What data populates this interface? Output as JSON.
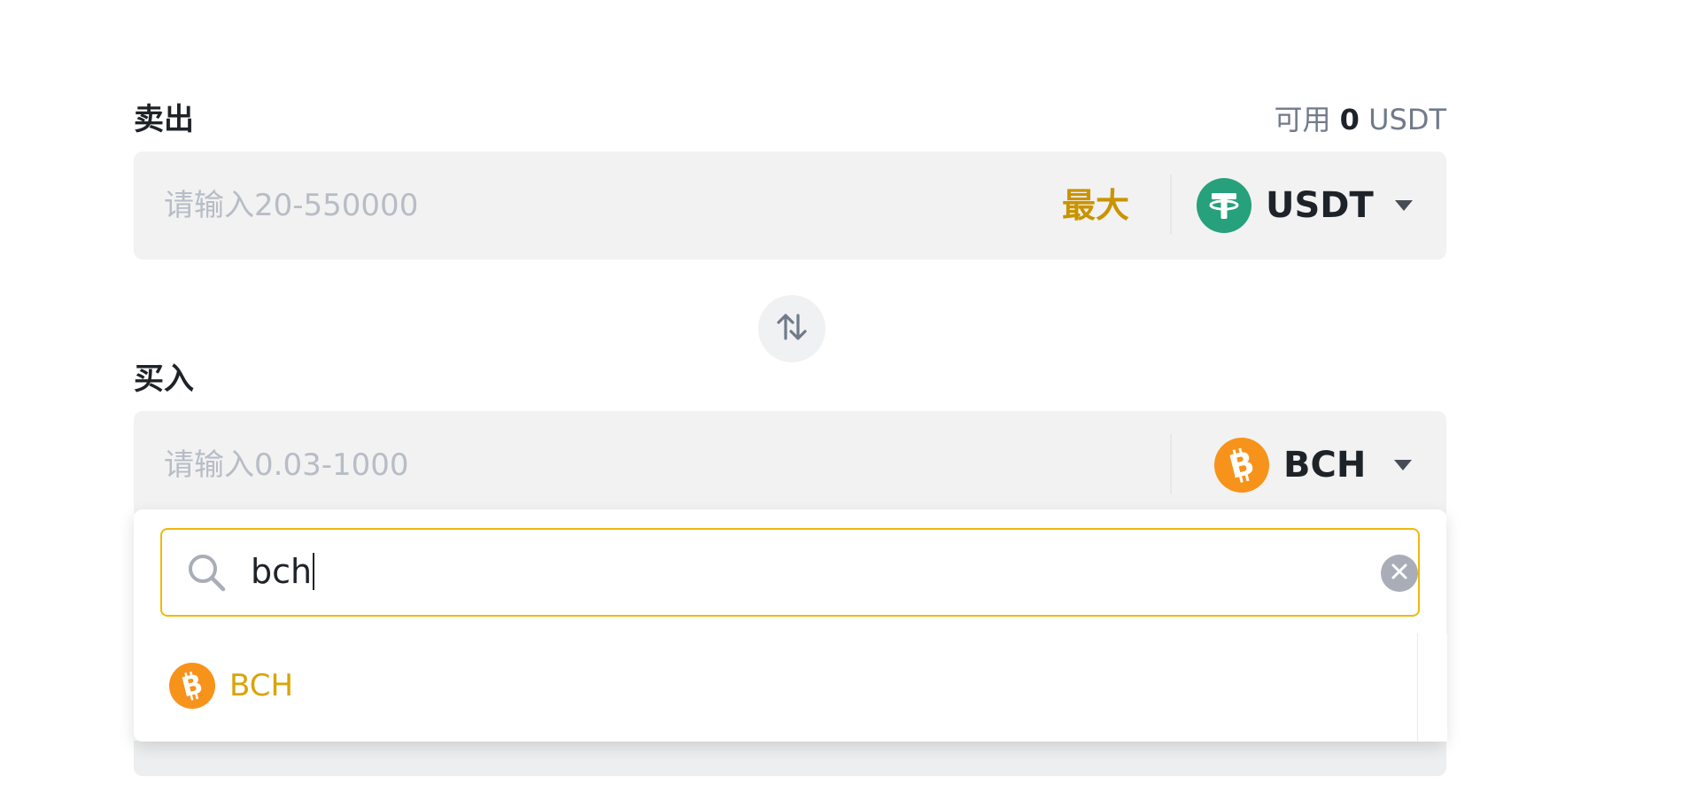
{
  "sell": {
    "label": "卖出",
    "available_prefix": "可用",
    "available_amount": "0",
    "available_unit": "USDT",
    "placeholder": "请输入20-550000",
    "max_label": "最大",
    "coin": "USDT",
    "coin_icon": "tether-icon",
    "coin_color": "#26a17b"
  },
  "swap": {
    "icon": "swap-vertical-icon"
  },
  "buy": {
    "label": "买入",
    "placeholder": "请输入0.03-1000",
    "coin": "BCH",
    "coin_icon": "bitcoin-cash-icon",
    "coin_color": "#f7931a"
  },
  "dropdown": {
    "search_value": "bch",
    "options": [
      {
        "label": "BCH",
        "icon": "bitcoin-cash-icon",
        "color": "#f7931a"
      }
    ]
  },
  "colors": {
    "accent": "#f0b90b",
    "max_text": "#c99400",
    "option_text": "#d9a406",
    "field_bg": "#f2f2f2"
  }
}
